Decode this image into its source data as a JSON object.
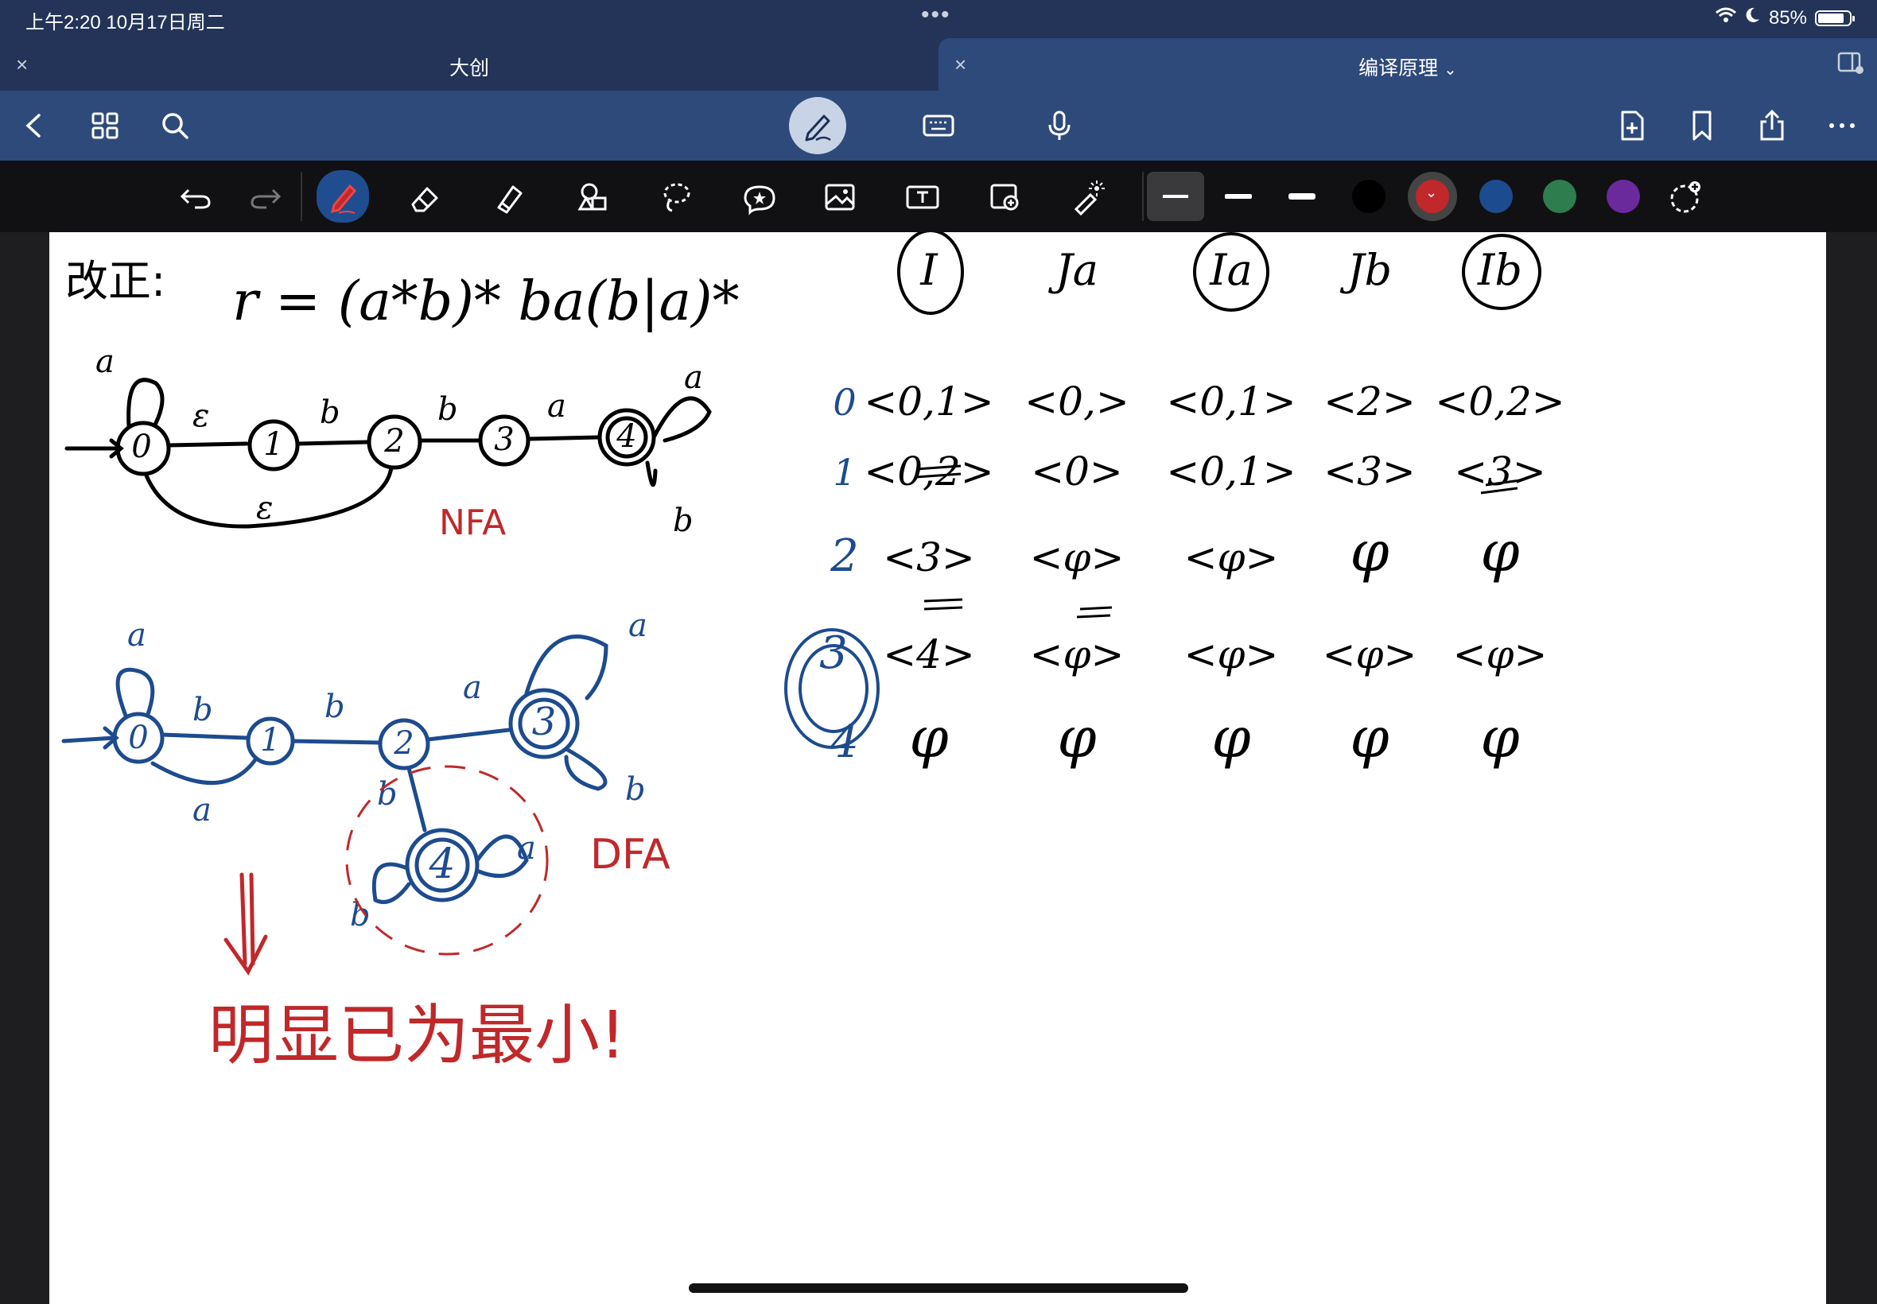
{
  "status": {
    "time": "上午2:20   10月17日周二",
    "dots": "•••",
    "battery": "85%",
    "battery_level": 0.85
  },
  "tabs": [
    {
      "title": "大创",
      "close": "×"
    },
    {
      "title": "编译原理",
      "close": "×"
    }
  ],
  "icons": {
    "nav": [
      "back-icon",
      "grid-icon",
      "search-icon",
      "pen-mode-icon",
      "keyboard-icon",
      "microphone-icon",
      "add-page-icon",
      "bookmark-icon",
      "share-icon",
      "more-icon"
    ],
    "tools": [
      "undo-icon",
      "redo-icon",
      "pen-icon",
      "eraser-icon",
      "highlighter-icon",
      "shapes-icon",
      "lasso-icon",
      "sticker-icon",
      "image-icon",
      "text-icon",
      "camera-icon",
      "laser-icon"
    ]
  },
  "colors": {
    "accent_navy": "#233458",
    "nav_blue": "#2e4a7a",
    "active_tool": "#1f4d8f",
    "ink_black": "#000000",
    "ink_red": "#c0282a",
    "ink_blue": "#1d4b8f"
  },
  "swatches": [
    "#000000",
    "#c0282a",
    "#1d4b8f",
    "#2e7d4f",
    "#6b2a9c"
  ],
  "note": {
    "correction_label": "改正:",
    "regex": "r = (a*b)* ba(b|a)*",
    "nfa_label": "NFA",
    "dfa_label": "DFA",
    "conclusion": "明显已为最小!",
    "table": {
      "headers": [
        "I",
        "Ja",
        "Ia",
        "Jb",
        "Ib"
      ],
      "rows": [
        {
          "id": "0",
          "cells": [
            "<0,1>",
            "<0,>",
            "<0,1>",
            "<2>",
            "<0,2>"
          ]
        },
        {
          "id": "1",
          "cells": [
            "<0,2>",
            "<0>",
            "<0,1>",
            "<3>",
            "<3>"
          ]
        },
        {
          "id": "2",
          "cells": [
            "<3>",
            "<φ>",
            "<φ>",
            "φ",
            "φ"
          ]
        },
        {
          "id": "3",
          "cells": [
            "<4>",
            "<φ>",
            "<φ>",
            "<φ>",
            "<φ>"
          ]
        },
        {
          "id": "4",
          "cells": [
            "φ",
            "φ",
            "φ",
            "φ",
            "φ"
          ]
        }
      ]
    },
    "nfa": {
      "states": [
        "0",
        "1",
        "2",
        "3",
        "4"
      ],
      "edges": [
        "a",
        "ε",
        "b",
        "b",
        "a",
        "ε",
        "a",
        "b"
      ]
    },
    "dfa": {
      "states": [
        "0",
        "1",
        "2",
        "3",
        "4"
      ],
      "edges": [
        "a",
        "b",
        "a",
        "b",
        "a",
        "a",
        "b",
        "b",
        "b",
        "a"
      ]
    }
  }
}
